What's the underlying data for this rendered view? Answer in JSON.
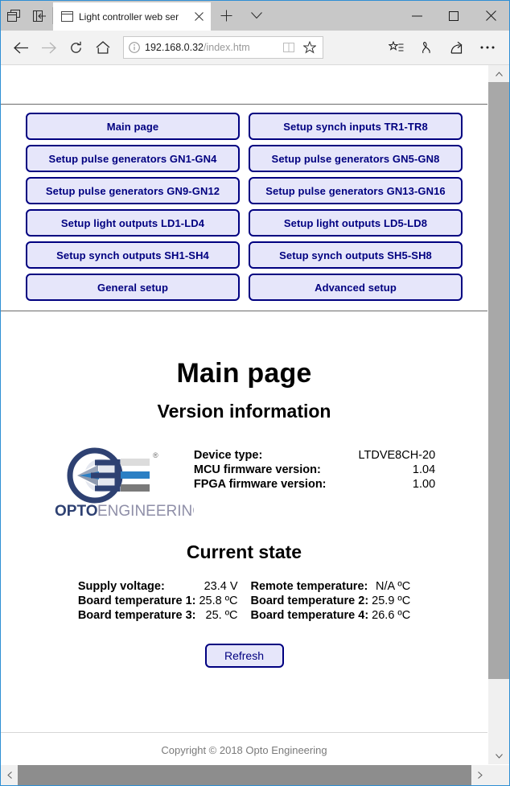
{
  "browser": {
    "tab": {
      "title": "Light controller web ser",
      "favicon_icon": "window-icon",
      "close_icon": "close-icon"
    },
    "newtab_icon": "plus-icon",
    "tablist_icon": "chevron-down-icon",
    "sys_icons": [
      "tab-preview-icon",
      "set-tabs-aside-icon"
    ],
    "window_controls": {
      "minimize_icon": "minimize-icon",
      "maximize_icon": "maximize-icon",
      "close_icon": "close-icon"
    },
    "toolbar": {
      "back_icon": "back-arrow-icon",
      "forward_icon": "forward-arrow-icon",
      "refresh_icon": "reload-icon",
      "home_icon": "home-icon",
      "info_icon": "info-circle-icon",
      "reading_view_icon": "book-icon",
      "favorite_icon": "star-icon",
      "favorites_hub_icon": "star-list-icon",
      "notes_icon": "pen-icon",
      "share_icon": "share-icon",
      "more_icon": "ellipsis-icon",
      "url_host": "192.168.0.32",
      "url_path": "/index.htm"
    },
    "scrollbars": {
      "v_up_icon": "chevron-up-icon",
      "v_down_icon": "chevron-down-icon",
      "h_left_icon": "chevron-left-icon",
      "h_right_icon": "chevron-right-icon"
    }
  },
  "nav": {
    "rows": [
      [
        {
          "label": "Main page"
        },
        {
          "label": "Setup synch inputs TR1-TR8"
        }
      ],
      [
        {
          "label": "Setup pulse generators GN1-GN4"
        },
        {
          "label": "Setup pulse generators GN5-GN8"
        }
      ],
      [
        {
          "label": "Setup pulse generators GN9-GN12"
        },
        {
          "label": "Setup pulse generators GN13-GN16"
        }
      ],
      [
        {
          "label": "Setup light outputs LD1-LD4"
        },
        {
          "label": "Setup light outputs LD5-LD8"
        }
      ],
      [
        {
          "label": "Setup synch outputs SH1-SH4"
        },
        {
          "label": "Setup synch outputs SH5-SH8"
        }
      ],
      [
        {
          "label": "General setup"
        },
        {
          "label": "Advanced setup"
        }
      ]
    ]
  },
  "page": {
    "title": "Main page",
    "version_heading": "Version information",
    "logo": {
      "name": "opto-engineering-logo",
      "wordmark_bold": "OPTO",
      "wordmark_light": "ENGINEERING",
      "registered_mark": "®",
      "colors": {
        "navy": "#2e4172",
        "blue": "#2b7fc4",
        "light_grey": "#dcdcdc",
        "grey": "#7a7a7a",
        "wordmark_bold": "#2e4172",
        "wordmark_light": "#8f8fa8"
      }
    },
    "version": [
      {
        "label": "Device type:",
        "value": "LTDVE8CH-20"
      },
      {
        "label": "MCU firmware version:",
        "value": "1.04"
      },
      {
        "label": "FPGA firmware version:",
        "value": "1.00"
      }
    ],
    "state_heading": "Current state",
    "state_rows": [
      {
        "left_label": "Supply voltage:",
        "left_value": "23.4 V",
        "right_label": "Remote temperature:",
        "right_value": "N/A ºC"
      },
      {
        "left_label": "Board temperature 1:",
        "left_value": "25.8 ºC",
        "right_label": "Board temperature 2:",
        "right_value": "25.9 ºC"
      },
      {
        "left_label": "Board temperature 3:",
        "left_value": "25. ºC",
        "right_label": "Board temperature 4:",
        "right_value": "26.6 ºC"
      }
    ],
    "refresh_label": "Refresh",
    "footer": "Copyright © 2018 Opto Engineering"
  },
  "theme": {
    "button_fill": "#e6e6fa",
    "button_border": "#000080",
    "button_text": "#000080",
    "footer_text": "#7a7a7a"
  }
}
